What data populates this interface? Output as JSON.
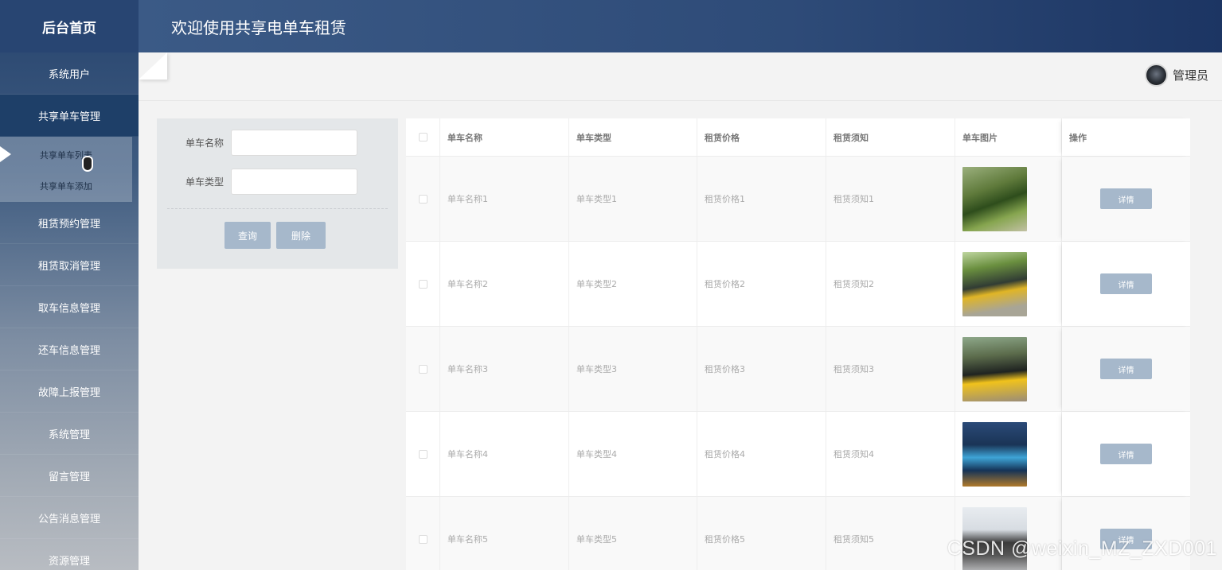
{
  "sidebar": {
    "title": "后台首页",
    "items": [
      {
        "label": "系统用户"
      },
      {
        "label": "共享单车管理"
      }
    ],
    "subitems": [
      {
        "label": "共享单车列表"
      },
      {
        "label": "共享单车添加"
      }
    ],
    "items_after": [
      {
        "label": "租赁预约管理"
      },
      {
        "label": "租赁取消管理"
      },
      {
        "label": "取车信息管理"
      },
      {
        "label": "还车信息管理"
      },
      {
        "label": "故障上报管理"
      },
      {
        "label": "系统管理"
      },
      {
        "label": "留言管理"
      },
      {
        "label": "公告消息管理"
      },
      {
        "label": "资源管理"
      }
    ]
  },
  "header": {
    "title": "欢迎使用共享电单车租赁"
  },
  "user": {
    "name": "管理员"
  },
  "search": {
    "name_label": "单车名称",
    "name_value": "",
    "type_label": "单车类型",
    "type_value": "",
    "query_button": "查询",
    "delete_button": "删除"
  },
  "table": {
    "columns": [
      "单车名称",
      "单车类型",
      "租赁价格",
      "租赁须知",
      "单车图片",
      "操作"
    ],
    "rows": [
      {
        "name": "单车名称1",
        "type": "单车类型1",
        "price": "租赁价格1",
        "notice": "租赁须知1",
        "image": "bike-photo-green-scooters",
        "action": "详情"
      },
      {
        "name": "单车名称2",
        "type": "单车类型2",
        "price": "租赁价格2",
        "notice": "租赁须知2",
        "image": "bike-photo-yellow-bikes",
        "action": "详情"
      },
      {
        "name": "单车名称3",
        "type": "单车类型3",
        "price": "租赁价格3",
        "notice": "租赁须知3",
        "image": "bike-photo-yellow-bikes-street",
        "action": "详情"
      },
      {
        "name": "单车名称4",
        "type": "单车类型4",
        "price": "租赁价格4",
        "notice": "租赁须知4",
        "image": "bike-photo-blue-bikes",
        "action": "详情"
      },
      {
        "name": "单车名称5",
        "type": "单车类型5",
        "price": "租赁价格5",
        "notice": "租赁须知5",
        "image": "bike-photo-electric-scooter",
        "action": "详情"
      }
    ]
  },
  "watermark": "CSDN @weixin_MZ_ZXD001",
  "colors": {
    "sidebar_top": "#27446e",
    "header": "#2e4b78",
    "button": "#a6b8cb",
    "active_item": "#1e3f68"
  }
}
